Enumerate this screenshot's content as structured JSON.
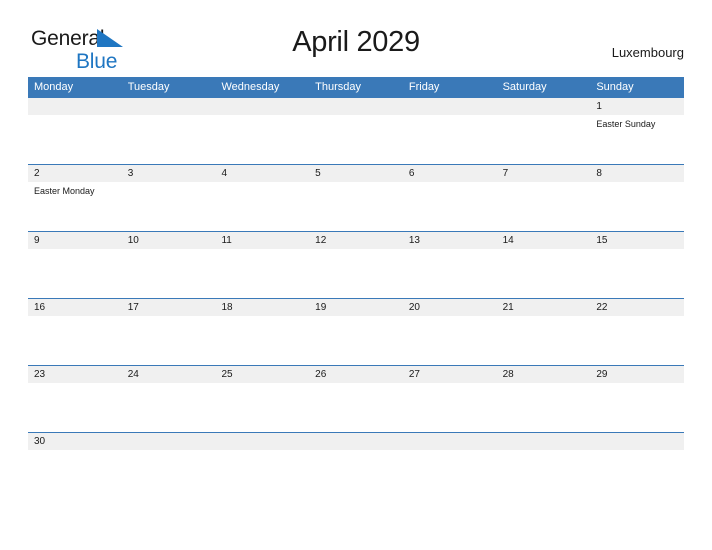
{
  "brand": {
    "name_part_1": "General",
    "name_part_2": "Blue",
    "flag_icon": "blue-triangle-flag-icon",
    "accent_color": "#1f76c2"
  },
  "header": {
    "title": "April 2029",
    "country": "Luxembourg"
  },
  "theme": {
    "header_blue": "#3a79b8",
    "date_band_gray": "#f0f0f0",
    "text_color": "#1a1a1a",
    "page_background": "#ffffff"
  },
  "calendar": {
    "weekdays": [
      "Monday",
      "Tuesday",
      "Wednesday",
      "Thursday",
      "Friday",
      "Saturday",
      "Sunday"
    ],
    "weeks": [
      {
        "days": [
          {
            "number": "",
            "events": []
          },
          {
            "number": "",
            "events": []
          },
          {
            "number": "",
            "events": []
          },
          {
            "number": "",
            "events": []
          },
          {
            "number": "",
            "events": []
          },
          {
            "number": "",
            "events": []
          },
          {
            "number": "1",
            "events": [
              "Easter Sunday"
            ]
          }
        ]
      },
      {
        "days": [
          {
            "number": "2",
            "events": [
              "Easter Monday"
            ]
          },
          {
            "number": "3",
            "events": []
          },
          {
            "number": "4",
            "events": []
          },
          {
            "number": "5",
            "events": []
          },
          {
            "number": "6",
            "events": []
          },
          {
            "number": "7",
            "events": []
          },
          {
            "number": "8",
            "events": []
          }
        ]
      },
      {
        "days": [
          {
            "number": "9",
            "events": []
          },
          {
            "number": "10",
            "events": []
          },
          {
            "number": "11",
            "events": []
          },
          {
            "number": "12",
            "events": []
          },
          {
            "number": "13",
            "events": []
          },
          {
            "number": "14",
            "events": []
          },
          {
            "number": "15",
            "events": []
          }
        ]
      },
      {
        "days": [
          {
            "number": "16",
            "events": []
          },
          {
            "number": "17",
            "events": []
          },
          {
            "number": "18",
            "events": []
          },
          {
            "number": "19",
            "events": []
          },
          {
            "number": "20",
            "events": []
          },
          {
            "number": "21",
            "events": []
          },
          {
            "number": "22",
            "events": []
          }
        ]
      },
      {
        "days": [
          {
            "number": "23",
            "events": []
          },
          {
            "number": "24",
            "events": []
          },
          {
            "number": "25",
            "events": []
          },
          {
            "number": "26",
            "events": []
          },
          {
            "number": "27",
            "events": []
          },
          {
            "number": "28",
            "events": []
          },
          {
            "number": "29",
            "events": []
          }
        ]
      },
      {
        "days": [
          {
            "number": "30",
            "events": []
          },
          {
            "number": "",
            "events": []
          },
          {
            "number": "",
            "events": []
          },
          {
            "number": "",
            "events": []
          },
          {
            "number": "",
            "events": []
          },
          {
            "number": "",
            "events": []
          },
          {
            "number": "",
            "events": []
          }
        ]
      }
    ]
  }
}
